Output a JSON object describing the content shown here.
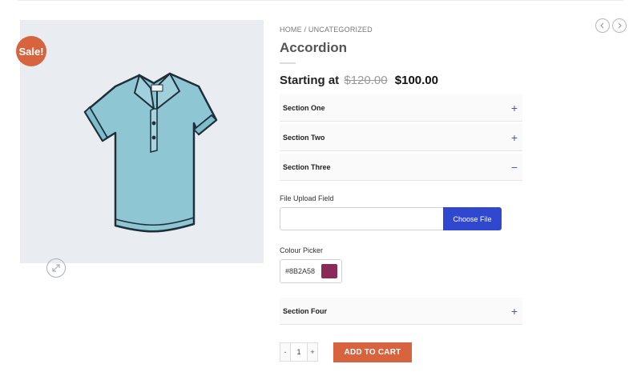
{
  "product": {
    "sale_badge": "Sale!",
    "breadcrumb": "HOME / UNCATEGORIZED",
    "title": "Accordion",
    "price_prefix": "Starting at",
    "price_old": "$120.00",
    "price_new": "$100.00"
  },
  "accordion": {
    "sections": [
      {
        "label": "Section One",
        "toggle": "+"
      },
      {
        "label": "Section Two",
        "toggle": "+"
      },
      {
        "label": "Section Three",
        "toggle": "−"
      },
      {
        "label": "Section Four",
        "toggle": "+"
      }
    ]
  },
  "fields": {
    "file_upload_label": "File Upload Field",
    "file_upload_value": "",
    "choose_file": "Choose File",
    "colour_picker_label": "Colour Picker",
    "colour_value": "#8B2A58"
  },
  "cart": {
    "minus": "-",
    "quantity": "1",
    "plus": "+",
    "add_to_cart": "ADD TO CART"
  },
  "colors": {
    "accent": "#d7643f",
    "primary_button": "#2f48cf",
    "swatch": "#8B2A58",
    "toggle": "#4b56a6"
  },
  "icons": {
    "zoom": "expand-icon",
    "prev": "chevron-left-icon",
    "next": "chevron-right-icon"
  }
}
